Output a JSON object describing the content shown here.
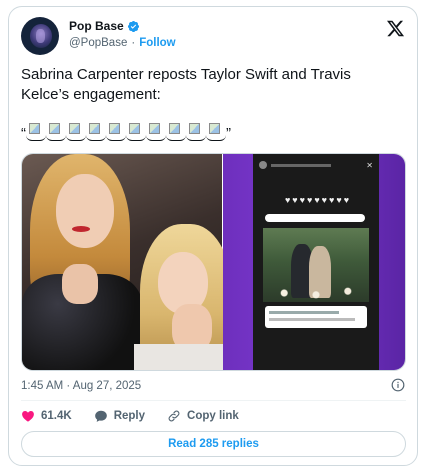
{
  "author": {
    "name": "Pop Base",
    "handle": "@PopBase",
    "separator": "·",
    "follow_label": "Follow"
  },
  "tweet": {
    "text": "Sabrina Carpenter reposts Taylor Swift and Travis Kelce’s engagement:",
    "quote_open": "“",
    "quote_close": "”",
    "emoji_count": 10
  },
  "meta": {
    "timestamp": "1:45 AM · Aug 27, 2025"
  },
  "actions": {
    "like_count": "61.4K",
    "reply_label": "Reply",
    "copy_label": "Copy link"
  },
  "replies_button": "Read 285 replies",
  "colors": {
    "accent": "#1d9bf0",
    "like": "#f91880",
    "text": "#0f1419",
    "muted": "#536471"
  },
  "icons": [
    "verified-badge-icon",
    "x-logo-icon",
    "info-icon",
    "heart-icon",
    "reply-icon",
    "link-icon",
    "broken-image-icon"
  ]
}
